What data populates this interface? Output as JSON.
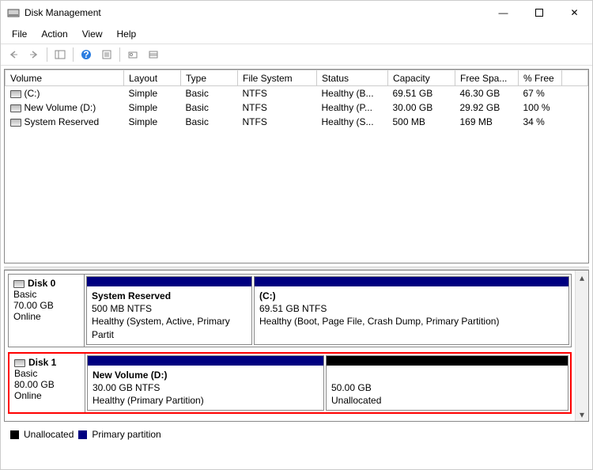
{
  "window": {
    "title": "Disk Management",
    "btn_min": "—",
    "btn_max": "▢",
    "btn_close": "✕"
  },
  "menu": {
    "file": "File",
    "action": "Action",
    "view": "View",
    "help": "Help"
  },
  "columns": {
    "volume": "Volume",
    "layout": "Layout",
    "type": "Type",
    "fs": "File System",
    "status": "Status",
    "capacity": "Capacity",
    "free": "Free Spa...",
    "pfree": "% Free"
  },
  "volumes": [
    {
      "name": "(C:)",
      "layout": "Simple",
      "type": "Basic",
      "fs": "NTFS",
      "status": "Healthy (B...",
      "cap": "69.51 GB",
      "free": "46.30 GB",
      "pfree": "67 %"
    },
    {
      "name": "New Volume (D:)",
      "layout": "Simple",
      "type": "Basic",
      "fs": "NTFS",
      "status": "Healthy (P...",
      "cap": "30.00 GB",
      "free": "29.92 GB",
      "pfree": "100 %"
    },
    {
      "name": "System Reserved",
      "layout": "Simple",
      "type": "Basic",
      "fs": "NTFS",
      "status": "Healthy (S...",
      "cap": "500 MB",
      "free": "169 MB",
      "pfree": "34 %"
    }
  ],
  "disk0": {
    "name": "Disk 0",
    "type": "Basic",
    "size": "70.00 GB",
    "status": "Online",
    "p1_title": "System Reserved",
    "p1_sub": "500 MB NTFS",
    "p1_stat": "Healthy (System, Active, Primary Partit",
    "p2_title": "(C:)",
    "p2_sub": "69.51 GB NTFS",
    "p2_stat": "Healthy (Boot, Page File, Crash Dump, Primary Partition)"
  },
  "disk1": {
    "name": "Disk 1",
    "type": "Basic",
    "size": "80.00 GB",
    "status": "Online",
    "p1_title": "New Volume  (D:)",
    "p1_sub": "30.00 GB NTFS",
    "p1_stat": "Healthy (Primary Partition)",
    "p2_sub": "50.00 GB",
    "p2_stat": "Unallocated"
  },
  "legend": {
    "unalloc": "Unallocated",
    "primary": "Primary partition"
  }
}
